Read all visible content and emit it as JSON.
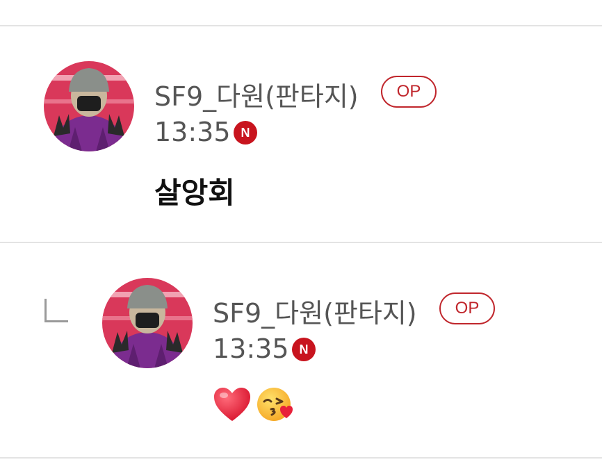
{
  "comments": [
    {
      "author": "SF9_다원(판타지)",
      "op_label": "OP",
      "time": "13:35",
      "new_label": "N",
      "text": "살앙회"
    },
    {
      "author": "SF9_다원(판타지)",
      "op_label": "OP",
      "time": "13:35",
      "new_label": "N",
      "emojis": [
        "heart-emoji",
        "kissing-face-emoji"
      ]
    }
  ],
  "colors": {
    "op_badge": "#c0262c",
    "new_badge": "#c8141e",
    "author_text": "#555555",
    "divider": "#e3e3e3"
  }
}
